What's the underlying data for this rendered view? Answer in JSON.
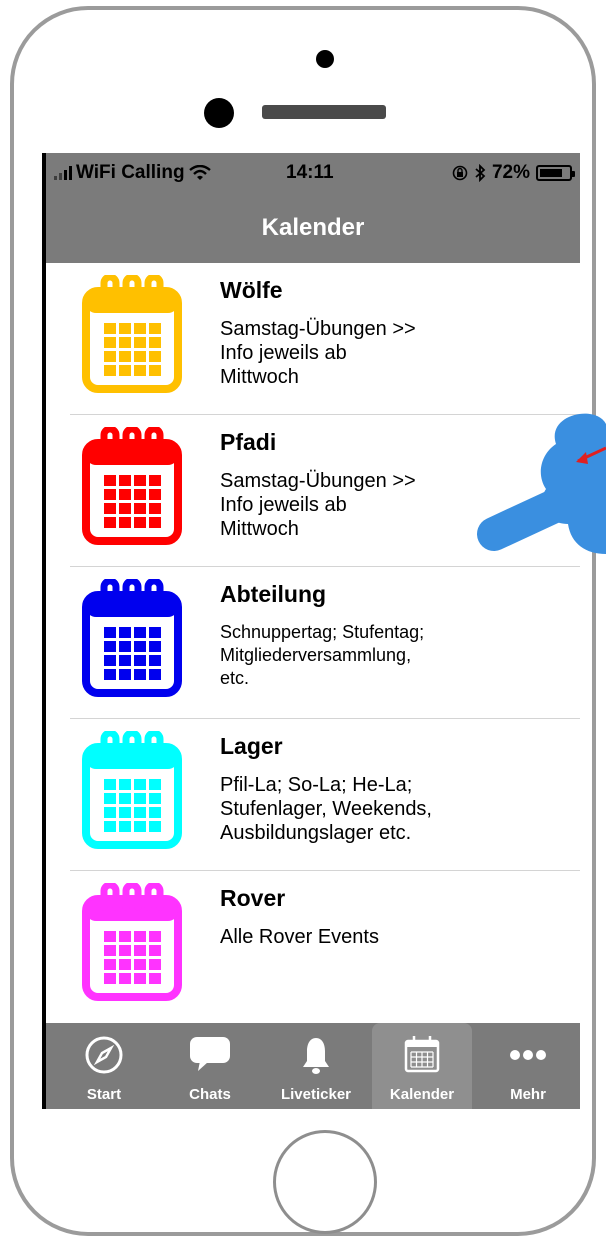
{
  "status": {
    "carrier": "WiFi Calling",
    "time": "14:11",
    "battery": "72%"
  },
  "nav": {
    "title": "Kalender"
  },
  "items": [
    {
      "title": "Wölfe",
      "desc": "Samstag-Übungen >>\nInfo jeweils ab\nMittwoch",
      "color": "#ffc000"
    },
    {
      "title": "Pfadi",
      "desc": "Samstag-Übungen >>\nInfo jeweils ab\nMittwoch",
      "color": "#ff0000"
    },
    {
      "title": "Abteilung",
      "desc": "Schnuppertag; Stufentag;\nMitgliederversammlung,\netc.",
      "color": "#0000ee"
    },
    {
      "title": "Lager",
      "desc": "Pfil-La; So-La; He-La;\nStufenlager, Weekends,\nAusbildungslager etc.",
      "color": "#00ffff"
    },
    {
      "title": "Rover",
      "desc": "Alle Rover Events",
      "color": "#ff33ff"
    }
  ],
  "tabs": [
    {
      "label": "Start",
      "icon": "compass-icon"
    },
    {
      "label": "Chats",
      "icon": "chat-bubble-icon"
    },
    {
      "label": "Liveticker",
      "icon": "bell-icon"
    },
    {
      "label": "Kalender",
      "icon": "calendar-icon",
      "active": true
    },
    {
      "label": "Mehr",
      "icon": "more-dots-icon"
    }
  ]
}
